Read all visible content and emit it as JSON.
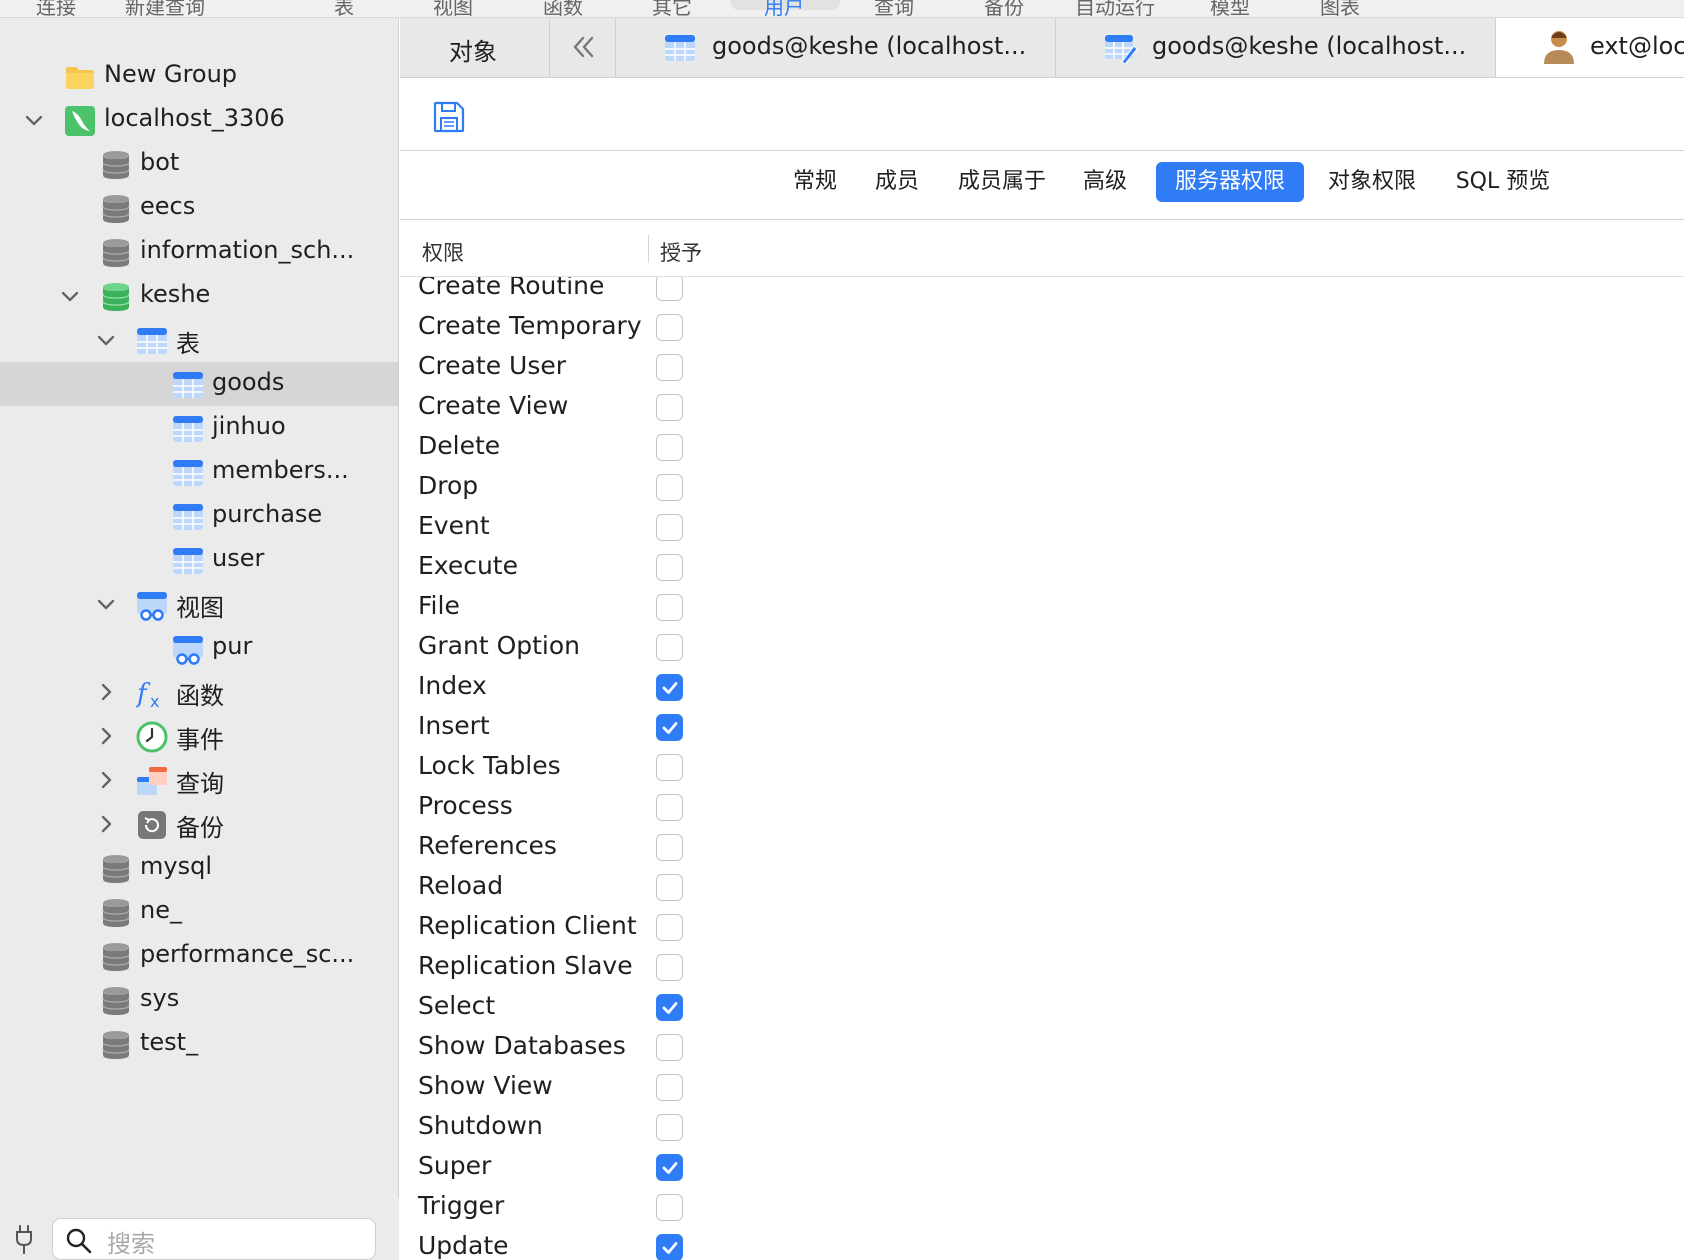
{
  "toolbar": {
    "items": [
      "连接",
      "新建查询",
      "表",
      "视图",
      "函数",
      "其它",
      "用户",
      "查询",
      "备份",
      "自动运行",
      "模型",
      "图表"
    ]
  },
  "sidebar": {
    "items": [
      {
        "label": "New Group",
        "icon": "folder-icon"
      },
      {
        "label": "localhost_3306",
        "icon": "mysql-connection-icon"
      },
      {
        "label": "bot",
        "icon": "database-icon"
      },
      {
        "label": "eecs",
        "icon": "database-icon"
      },
      {
        "label": "information_sch...",
        "icon": "database-icon"
      },
      {
        "label": "keshe",
        "icon": "database-open-icon"
      },
      {
        "label": "表",
        "icon": "tables-icon"
      },
      {
        "label": "goods",
        "icon": "table-icon"
      },
      {
        "label": "jinhuo",
        "icon": "table-icon"
      },
      {
        "label": "members...",
        "icon": "table-icon"
      },
      {
        "label": "purchase",
        "icon": "table-icon"
      },
      {
        "label": "user",
        "icon": "table-icon"
      },
      {
        "label": "视图",
        "icon": "views-icon"
      },
      {
        "label": "pur",
        "icon": "view-icon"
      },
      {
        "label": "函数",
        "icon": "function-icon"
      },
      {
        "label": "事件",
        "icon": "event-clock-icon"
      },
      {
        "label": "查询",
        "icon": "query-icon"
      },
      {
        "label": "备份",
        "icon": "backup-icon"
      },
      {
        "label": "mysql",
        "icon": "database-icon"
      },
      {
        "label": "ne_",
        "icon": "database-icon"
      },
      {
        "label": "performance_sc...",
        "icon": "database-icon"
      },
      {
        "label": "sys",
        "icon": "database-icon"
      },
      {
        "label": "test_",
        "icon": "database-icon"
      }
    ],
    "search_placeholder": "搜索"
  },
  "tabs": [
    {
      "label": "对象"
    },
    {
      "label": "goods@keshe (localhost..."
    },
    {
      "label": "goods@keshe (localhost..."
    },
    {
      "label": "ext@loca"
    }
  ],
  "subtabs": [
    "常规",
    "成员",
    "成员属于",
    "高级",
    "服务器权限",
    "对象权限",
    "SQL 预览"
  ],
  "table": {
    "headers": [
      "权限",
      "授予"
    ],
    "rows": [
      {
        "name": "Create Routine",
        "granted": false
      },
      {
        "name": "Create Temporary",
        "granted": false
      },
      {
        "name": "Create User",
        "granted": false
      },
      {
        "name": "Create View",
        "granted": false
      },
      {
        "name": "Delete",
        "granted": false
      },
      {
        "name": "Drop",
        "granted": false
      },
      {
        "name": "Event",
        "granted": false
      },
      {
        "name": "Execute",
        "granted": false
      },
      {
        "name": "File",
        "granted": false
      },
      {
        "name": "Grant Option",
        "granted": false
      },
      {
        "name": "Index",
        "granted": true
      },
      {
        "name": "Insert",
        "granted": true
      },
      {
        "name": "Lock Tables",
        "granted": false
      },
      {
        "name": "Process",
        "granted": false
      },
      {
        "name": "References",
        "granted": false
      },
      {
        "name": "Reload",
        "granted": false
      },
      {
        "name": "Replication Client",
        "granted": false
      },
      {
        "name": "Replication Slave",
        "granted": false
      },
      {
        "name": "Select",
        "granted": true
      },
      {
        "name": "Show Databases",
        "granted": false
      },
      {
        "name": "Show View",
        "granted": false
      },
      {
        "name": "Shutdown",
        "granted": false
      },
      {
        "name": "Super",
        "granted": true
      },
      {
        "name": "Trigger",
        "granted": false
      },
      {
        "name": "Update",
        "granted": true
      }
    ]
  },
  "colors": {
    "accent": "#2f7cf6",
    "sidebar_bg": "#ebebeb",
    "selected_row": "#d6d6d6"
  }
}
